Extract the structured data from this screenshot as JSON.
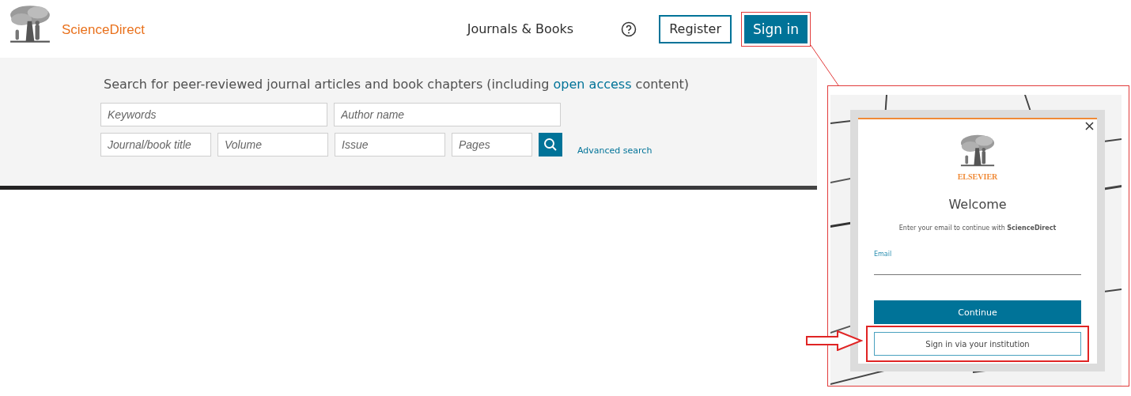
{
  "header": {
    "logo_text": "ScienceDirect",
    "nav_link": "Journals & Books",
    "register_button": "Register",
    "signin_button": "Sign in"
  },
  "search": {
    "intro_before": "Search for peer-reviewed journal articles and book chapters (including",
    "intro_link": "open access",
    "intro_after": "content)",
    "fields": [
      {
        "placeholder": "Keywords",
        "kind": "wide"
      },
      {
        "placeholder": "Author name",
        "kind": "wide"
      },
      {
        "placeholder": "Journal/book title",
        "kind": "narrow"
      },
      {
        "placeholder": "Volume",
        "kind": "narrow"
      },
      {
        "placeholder": "Issue",
        "kind": "narrow"
      },
      {
        "placeholder": "Pages",
        "kind": "short"
      }
    ],
    "advanced_link": "Advanced search"
  },
  "inset": {
    "kind": "picture",
    "modal": {
      "brand": "ELSEVIER",
      "title": "Welcome",
      "subtitle": "Enter your email to continue with **ScienceDirect**",
      "email_label": "Email",
      "continue_button": "Continue",
      "institution_button": "Sign in via your institution"
    }
  }
}
